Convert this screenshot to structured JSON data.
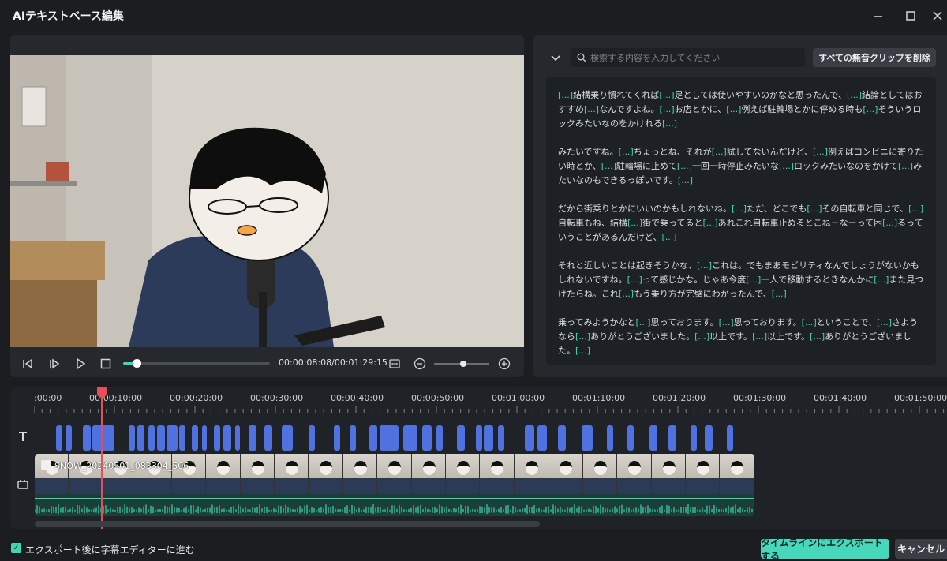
{
  "window": {
    "title": "AIテキストベース編集",
    "minimize_icon": "minimize-icon",
    "maximize_icon": "maximize-icon",
    "close_icon": "close-icon"
  },
  "player": {
    "current_time": "00:00:08:08",
    "total_time": "00:01:29:15",
    "timecode_separator": "/",
    "progress": 0.093,
    "zoom_level": 0.5
  },
  "transcript_panel": {
    "search_placeholder": "検索する内容を入力してください",
    "delete_silent_label": "すべての無音クリップを削除",
    "silence_tag": "[...]",
    "paragraphs": [
      [
        {
          "t": "tag"
        },
        {
          "t": "text",
          "v": "結構乗り慣れてくれば"
        },
        {
          "t": "tag"
        },
        {
          "t": "text",
          "v": "足としては使いやすいのかなと思ったんで、"
        },
        {
          "t": "tag"
        },
        {
          "t": "text",
          "v": "結論としてはおすすめ"
        },
        {
          "t": "tag"
        },
        {
          "t": "text",
          "v": "なんですよね。"
        },
        {
          "t": "tag"
        },
        {
          "t": "text",
          "v": "お店とかに、"
        },
        {
          "t": "tag"
        },
        {
          "t": "text",
          "v": "例えば駐輪場とかに停める時も"
        },
        {
          "t": "tag"
        },
        {
          "t": "text",
          "v": "そういうロックみたいなのをかけれる"
        },
        {
          "t": "tag"
        }
      ],
      [
        {
          "t": "text",
          "v": "みたいですね。"
        },
        {
          "t": "tag"
        },
        {
          "t": "text",
          "v": "ちょっとね、それが"
        },
        {
          "t": "tag"
        },
        {
          "t": "text",
          "v": "試してないんだけど、"
        },
        {
          "t": "tag"
        },
        {
          "t": "text",
          "v": "例えばコンビニに寄りたい時とか、"
        },
        {
          "t": "tag"
        },
        {
          "t": "text",
          "v": "駐輪場に止めて"
        },
        {
          "t": "tag"
        },
        {
          "t": "text",
          "v": "一回一時停止みたいな"
        },
        {
          "t": "tag"
        },
        {
          "t": "text",
          "v": "ロックみたいなのをかけて"
        },
        {
          "t": "tag"
        },
        {
          "t": "text",
          "v": "みたいなのもできるっぽいです。"
        },
        {
          "t": "tag"
        }
      ],
      [
        {
          "t": "text",
          "v": "だから街乗りとかにいいのかもしれないね。"
        },
        {
          "t": "tag"
        },
        {
          "t": "text",
          "v": "ただ、どこでも"
        },
        {
          "t": "tag"
        },
        {
          "t": "text",
          "v": "その自転車と同じで、"
        },
        {
          "t": "tag"
        },
        {
          "t": "text",
          "v": "自転車もね、結構"
        },
        {
          "t": "tag"
        },
        {
          "t": "text",
          "v": "街で乗ってると"
        },
        {
          "t": "tag"
        },
        {
          "t": "text",
          "v": "あれこれ自転車止めるとこね－なーって困"
        },
        {
          "t": "tag"
        },
        {
          "t": "text",
          "v": "るっていうことがあるんだけど、"
        },
        {
          "t": "tag"
        }
      ],
      [
        {
          "t": "text",
          "v": "それと近しいことは起きそうかな、"
        },
        {
          "t": "tag"
        },
        {
          "t": "text",
          "v": "これは。でもまあモビリティなんでしょうがないかもしれないですね。"
        },
        {
          "t": "tag"
        },
        {
          "t": "text",
          "v": "って感じかな。じゃあ今度"
        },
        {
          "t": "tag"
        },
        {
          "t": "text",
          "v": "一人で移動するときなんかに"
        },
        {
          "t": "tag"
        },
        {
          "t": "text",
          "v": "また見つけたらね。これ"
        },
        {
          "t": "tag"
        },
        {
          "t": "text",
          "v": "もう乗り方が完璧にわかったんで、"
        },
        {
          "t": "tag"
        }
      ],
      [
        {
          "t": "text",
          "v": "乗ってみようかなと"
        },
        {
          "t": "tag"
        },
        {
          "t": "text",
          "v": "思っております。"
        },
        {
          "t": "tag"
        },
        {
          "t": "text",
          "v": "思っております。"
        },
        {
          "t": "tag"
        },
        {
          "t": "text",
          "v": "ということで、"
        },
        {
          "t": "tag"
        },
        {
          "t": "text",
          "v": "さようなら"
        },
        {
          "t": "tag"
        },
        {
          "t": "text",
          "v": "ありがとうございました。"
        },
        {
          "t": "tag"
        },
        {
          "t": "text",
          "v": "以上です。"
        },
        {
          "t": "tag"
        },
        {
          "t": "text",
          "v": "以上です。"
        },
        {
          "t": "tag"
        },
        {
          "t": "text",
          "v": "ありがとうございました。"
        },
        {
          "t": "tag"
        }
      ]
    ]
  },
  "timeline": {
    "ruler_labels": [
      ":00:00",
      "00:00:10:00",
      "00:00:20:00",
      "00:00:30:00",
      "00:00:40:00",
      "00:00:50:00",
      "00:01:00:00",
      "00:01:10:00",
      "00:01:20:00",
      "00:01:30:00",
      "00:01:40:00",
      "00:01:50:00"
    ],
    "clip_name": "SNOW_20240501_083304_506",
    "text_track_icon": "text-track-icon",
    "video_track_icon": "video-track-icon"
  },
  "footer": {
    "checkbox_label": "エクスポート後に字幕エディターに進む",
    "checkbox_checked": true,
    "export_label": "タイムラインにエクスポートする",
    "cancel_label": "キャンセル"
  },
  "colors": {
    "accent": "#3fd6b4",
    "playhead": "#e84d5b",
    "subtitle_block": "#4f72e0"
  }
}
